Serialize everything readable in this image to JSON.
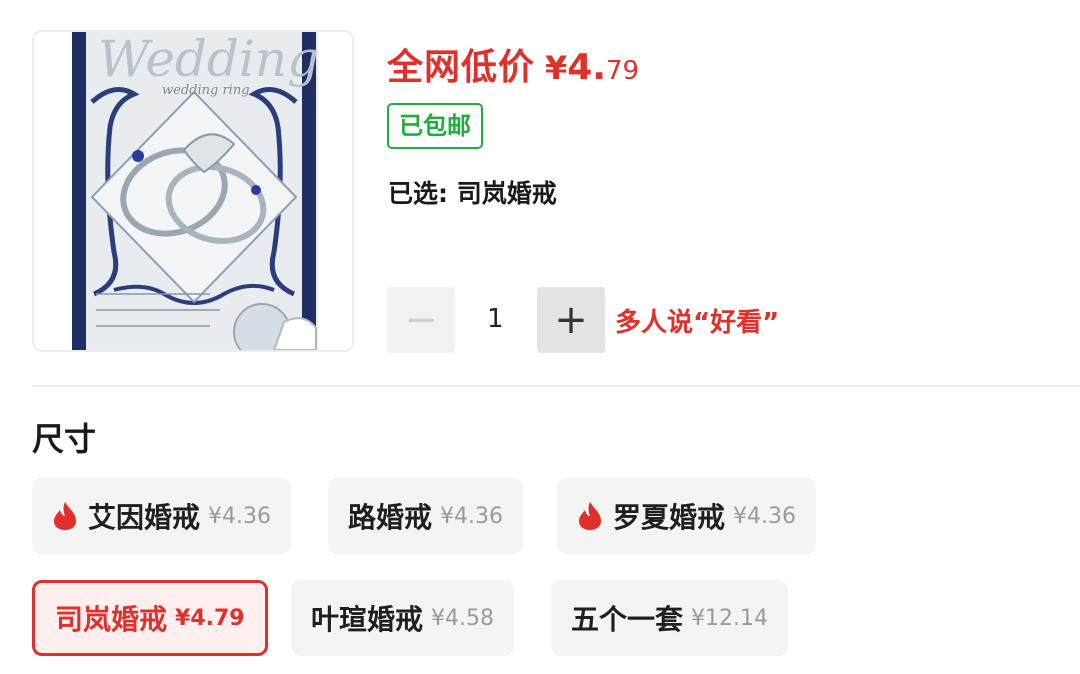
{
  "product": {
    "image_alt": "Wedding ring card",
    "image_title_text": "Wedding",
    "image_subtitle_text": "wedding ring",
    "price_label": "全网低价",
    "currency": "¥",
    "price_int": "4.",
    "price_dec": "79",
    "shipping_badge": "已包邮",
    "selected_text": "已选: 司岚婚戒"
  },
  "quantity": {
    "value": "1",
    "minus_symbol": "−",
    "plus_symbol": "+",
    "hot_text": "多人说“好看”"
  },
  "options": {
    "section_title": "尺寸",
    "items": [
      {
        "name": "艾因婚戒",
        "price": "¥4.36",
        "hot": true,
        "selected": false
      },
      {
        "name": "路婚戒",
        "price": "¥4.36",
        "hot": false,
        "selected": false
      },
      {
        "name": "罗夏婚戒",
        "price": "¥4.36",
        "hot": true,
        "selected": false
      },
      {
        "name": "司岚婚戒",
        "price": "¥4.79",
        "hot": false,
        "selected": true
      },
      {
        "name": "叶瑄婚戒",
        "price": "¥4.58",
        "hot": false,
        "selected": false
      },
      {
        "name": "五个一套",
        "price": "¥12.14",
        "hot": false,
        "selected": false
      }
    ]
  },
  "colors": {
    "accent_red": "#e0302b",
    "shipping_green": "#1fae3d",
    "chip_bg": "#f4f4f4",
    "selected_chip_bg": "#fff0ef"
  }
}
